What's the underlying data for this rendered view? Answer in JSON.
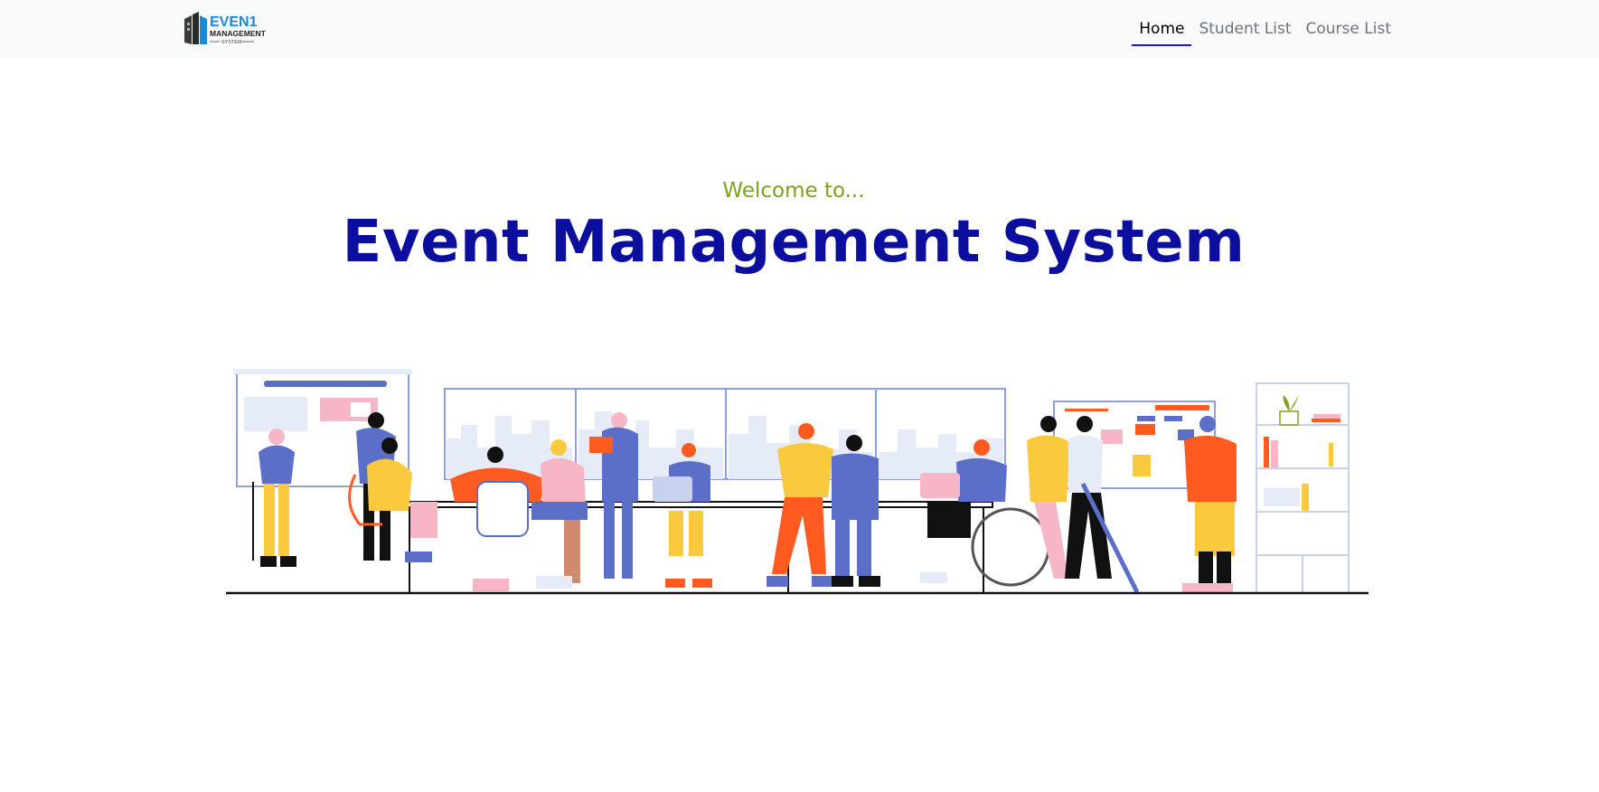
{
  "navbar": {
    "logo": {
      "line1": "EVEN1",
      "line2": "MANAGEMENT",
      "line3": "SYSTEM",
      "colors": {
        "dark": "#3a3a3a",
        "blue": "#1e88d8"
      }
    },
    "links": [
      {
        "label": "Home",
        "active": true
      },
      {
        "label": "Student List",
        "active": false
      },
      {
        "label": "Course List",
        "active": false
      }
    ]
  },
  "hero": {
    "welcome": "Welcome to...",
    "title": "Event Management System",
    "colors": {
      "welcome": "#7ca21b",
      "title": "#0c0f9e",
      "nav_active_underline": "#1a1ad6"
    }
  },
  "illustration": {
    "name": "office-team-meeting",
    "colors": {
      "blue": "#5b6fc9",
      "yellow": "#fbc93e",
      "orange": "#ff5a1f",
      "pink": "#f7b6c6",
      "black": "#111111",
      "light": "#e6ebf8"
    }
  }
}
